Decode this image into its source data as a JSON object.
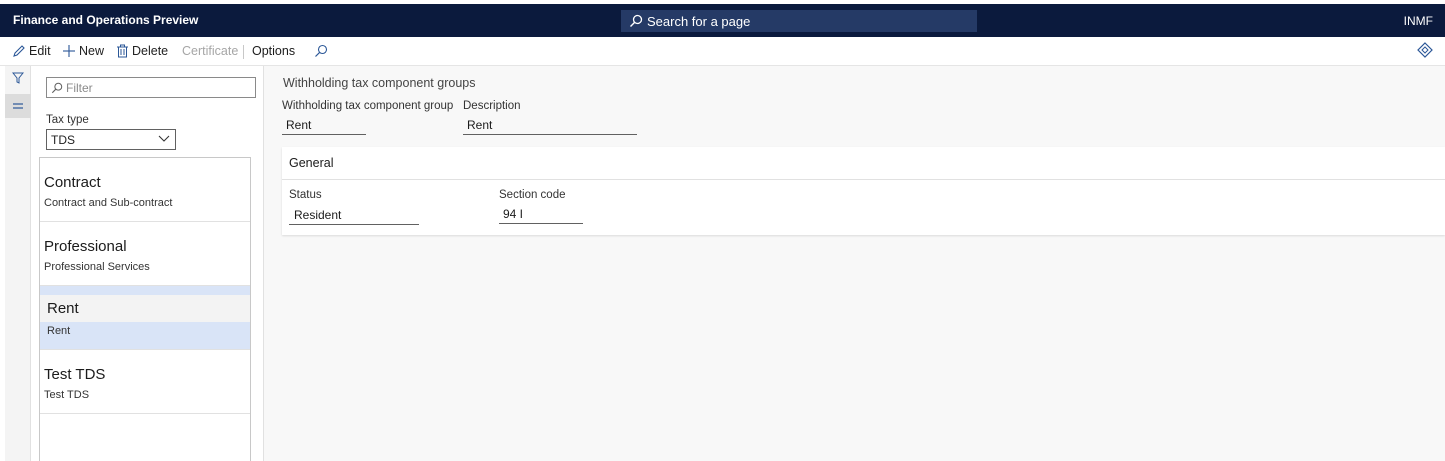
{
  "app": {
    "title": "Finance and Operations Preview",
    "company": "INMF"
  },
  "search": {
    "label": "Search for a page"
  },
  "actions": {
    "edit": "Edit",
    "new": "New",
    "delete": "Delete",
    "certificate": "Certificate",
    "options": "Options"
  },
  "list": {
    "filter_placeholder": "Filter",
    "tax_type_label": "Tax type",
    "tax_type_value": "TDS",
    "items": [
      {
        "title": "Contract",
        "subtitle": "Contract and Sub-contract"
      },
      {
        "title": "Professional",
        "subtitle": "Professional Services"
      },
      {
        "title": "Rent",
        "subtitle": "Rent"
      },
      {
        "title": "Test TDS",
        "subtitle": "Test TDS"
      }
    ],
    "selected_index": 2
  },
  "detail": {
    "caption": "Withholding tax component groups",
    "group_label": "Withholding tax component group",
    "group_value": "Rent",
    "description_label": "Description",
    "description_value": "Rent",
    "general": {
      "title": "General",
      "status_label": "Status",
      "status_value": "Resident",
      "section_label": "Section code",
      "section_value": "94 I"
    }
  },
  "icons": [
    "search-icon",
    "edit-icon",
    "plus-icon",
    "trash-icon",
    "diamond-icon",
    "funnel-icon",
    "list-icon",
    "chevron-down-icon"
  ],
  "colors": {
    "header": "#0b1a3d",
    "search_box": "#253a66",
    "selected_row": "#d9e4f7"
  }
}
